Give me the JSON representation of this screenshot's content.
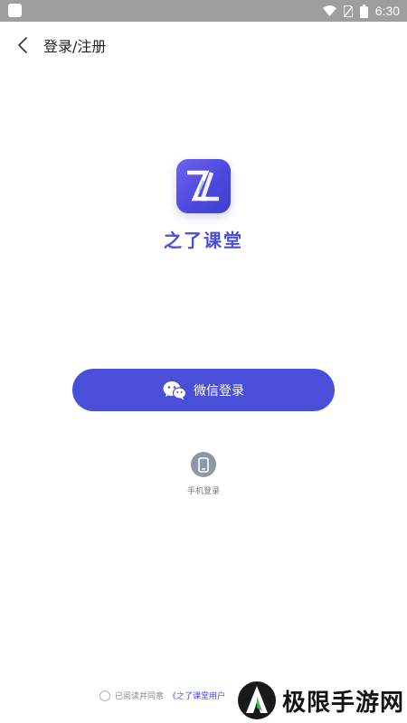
{
  "status_bar": {
    "time": "6:30"
  },
  "top_bar": {
    "title": "登录/注册"
  },
  "app": {
    "name": "之了课堂",
    "logo_letters": "ZL"
  },
  "login": {
    "wechat_label": "微信登录",
    "phone_label": "手机登录"
  },
  "agreement": {
    "prefix": "已阅读并同意",
    "link": "《之了课堂用户"
  },
  "watermark": {
    "text": "极限手游网"
  },
  "colors": {
    "brand": "#4a4fd9",
    "status_bar": "#9e9e9e",
    "phone_icon_bg": "#8e97a6"
  }
}
